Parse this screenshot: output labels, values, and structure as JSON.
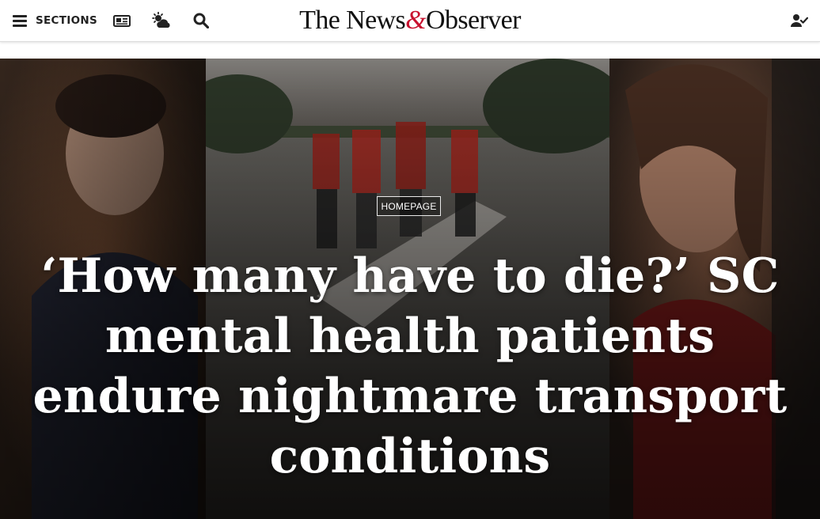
{
  "header": {
    "sections_label": "SECTIONS",
    "logo_before": "The News",
    "logo_amp": "&",
    "logo_after": "Observer",
    "icons": [
      "menu-icon",
      "e-edition-icon",
      "weather-icon",
      "search-icon",
      "account-icon"
    ]
  },
  "hero": {
    "badge": "HOMEPAGE",
    "headline": "‘How many have to die?’ SC mental health patients endure nightmare transport conditions"
  },
  "colors": {
    "brand_red": "#c8102e",
    "header_text": "#222222",
    "headline": "#ffffff"
  }
}
